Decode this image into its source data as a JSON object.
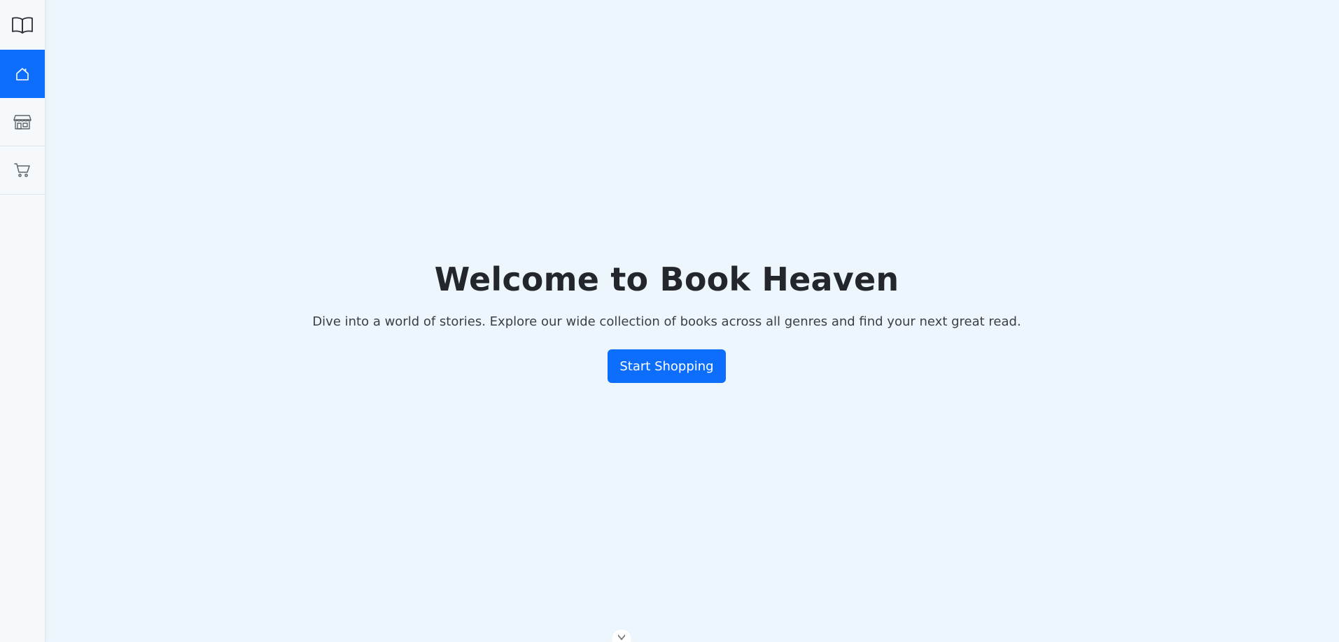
{
  "sidebar": {
    "items": [
      {
        "icon": "book-open-icon",
        "active": false
      },
      {
        "icon": "home-icon",
        "active": true
      },
      {
        "icon": "shop-icon",
        "active": false
      },
      {
        "icon": "cart-icon",
        "active": false
      }
    ]
  },
  "hero": {
    "title": "Welcome to Book Heaven",
    "subtitle": "Dive into a world of stories. Explore our wide collection of books across all genres and find your next great read.",
    "button_label": "Start Shopping"
  },
  "scroll_hint": {
    "icon": "chevron-down-icon"
  },
  "colors": {
    "accent": "#0d6efd",
    "background": "#eef6fd",
    "sidebar": "#f6f9fb",
    "heading": "#23272b"
  }
}
